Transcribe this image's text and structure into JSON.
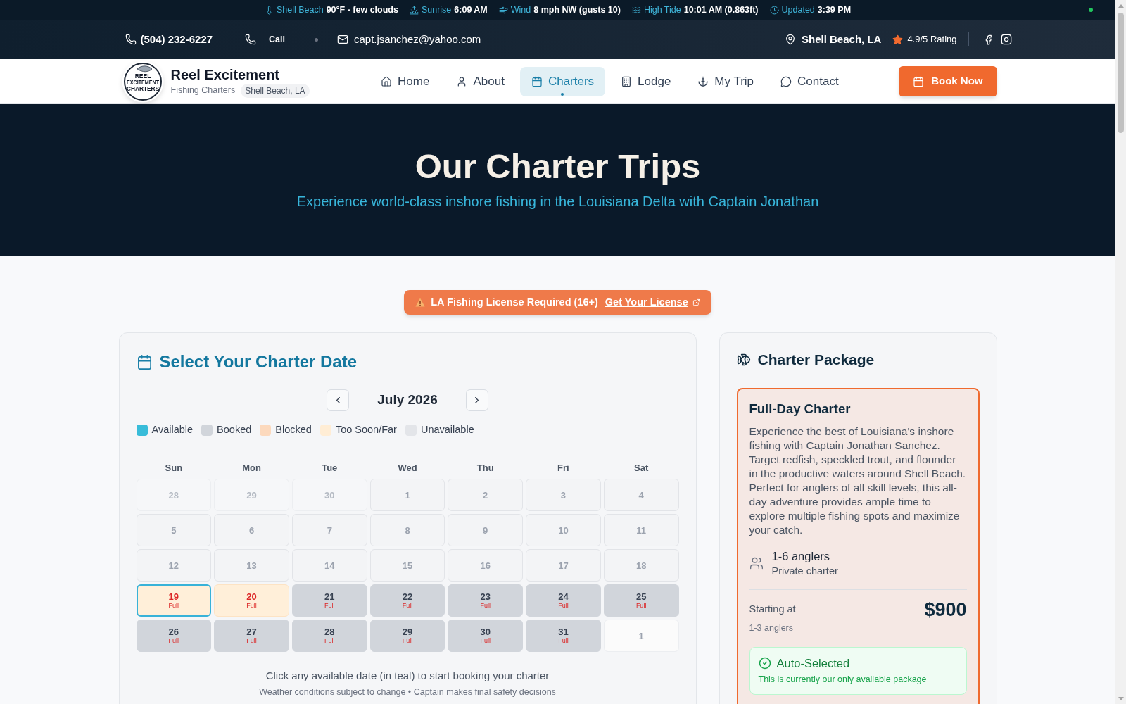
{
  "weather_bar": {
    "items": [
      {
        "label": "Shell Beach",
        "value": "90°F - few clouds"
      },
      {
        "label": "Sunrise",
        "value": "6:09 AM"
      },
      {
        "label": "Wind",
        "value": "8 mph NW (gusts 10)"
      },
      {
        "label": "High Tide",
        "value": "10:01 AM (0.863ft)"
      },
      {
        "label": "Updated",
        "value": "3:39 PM"
      }
    ]
  },
  "contact_bar": {
    "phone": "(504) 232-6227",
    "call": "Call",
    "email": "capt.jsanchez@yahoo.com",
    "location": "Shell Beach, LA",
    "rating": "4.9/5 Rating"
  },
  "nav": {
    "logo": {
      "lines": [
        "REEL",
        "EXCITEMENT",
        "CHARTERS"
      ]
    },
    "brand": {
      "name": "Reel Excitement",
      "tagline": "Fishing Charters",
      "badge": "Shell Beach, LA"
    },
    "items": [
      {
        "label": "Home",
        "selected": false
      },
      {
        "label": "About",
        "selected": false
      },
      {
        "label": "Charters",
        "selected": true
      },
      {
        "label": "Lodge",
        "selected": false
      },
      {
        "label": "My Trip",
        "selected": false
      },
      {
        "label": "Contact",
        "selected": false
      }
    ],
    "cta": "Book Now"
  },
  "hero": {
    "title": "Our Charter Trips",
    "subtitle": "Experience world-class inshore fishing in the Louisiana Delta with Captain Jonathan"
  },
  "license_banner": {
    "text": "LA Fishing License Required (16+)",
    "link": "Get Your License"
  },
  "calendar": {
    "title": "Select Your Charter Date",
    "month": "July 2026",
    "legend": [
      {
        "label": "Available",
        "color": "#38bcd9"
      },
      {
        "label": "Booked",
        "color": "#d1d5db"
      },
      {
        "label": "Blocked",
        "color": "#fcd9bd"
      },
      {
        "label": "Too Soon/Far",
        "color": "#ffedd5"
      },
      {
        "label": "Unavailable",
        "color": "#e3e5e9"
      }
    ],
    "weekdays": [
      "Sun",
      "Mon",
      "Tue",
      "Wed",
      "Thu",
      "Fri",
      "Sat"
    ],
    "days": [
      {
        "day": "28",
        "kind": "outside-past",
        "selected": false
      },
      {
        "day": "29",
        "kind": "outside-past",
        "selected": false
      },
      {
        "day": "30",
        "kind": "outside-past",
        "selected": false
      },
      {
        "day": "1",
        "kind": "unavailable",
        "selected": false
      },
      {
        "day": "2",
        "kind": "unavailable",
        "selected": false
      },
      {
        "day": "3",
        "kind": "unavailable",
        "selected": false
      },
      {
        "day": "4",
        "kind": "unavailable",
        "selected": false
      },
      {
        "day": "5",
        "kind": "unavailable",
        "selected": false
      },
      {
        "day": "6",
        "kind": "unavailable",
        "selected": false
      },
      {
        "day": "7",
        "kind": "unavailable",
        "selected": false
      },
      {
        "day": "8",
        "kind": "unavailable",
        "selected": false
      },
      {
        "day": "9",
        "kind": "unavailable",
        "selected": false
      },
      {
        "day": "10",
        "kind": "unavailable",
        "selected": false
      },
      {
        "day": "11",
        "kind": "unavailable",
        "selected": false
      },
      {
        "day": "12",
        "kind": "unavailable",
        "selected": false
      },
      {
        "day": "13",
        "kind": "unavailable",
        "selected": false
      },
      {
        "day": "14",
        "kind": "unavailable",
        "selected": false
      },
      {
        "day": "15",
        "kind": "unavailable",
        "selected": false
      },
      {
        "day": "16",
        "kind": "unavailable",
        "selected": false
      },
      {
        "day": "17",
        "kind": "unavailable",
        "selected": false
      },
      {
        "day": "18",
        "kind": "unavailable",
        "selected": false
      },
      {
        "day": "19",
        "kind": "too-soon",
        "note": "Full",
        "selected": true
      },
      {
        "day": "20",
        "kind": "too-soon",
        "note": "Full",
        "selected": false
      },
      {
        "day": "21",
        "kind": "booked",
        "note": "Full",
        "selected": false
      },
      {
        "day": "22",
        "kind": "booked",
        "note": "Full",
        "selected": false
      },
      {
        "day": "23",
        "kind": "booked",
        "note": "Full",
        "selected": false
      },
      {
        "day": "24",
        "kind": "booked",
        "note": "Full",
        "selected": false
      },
      {
        "day": "25",
        "kind": "booked",
        "note": "Full",
        "selected": false
      },
      {
        "day": "26",
        "kind": "booked",
        "note": "Full",
        "selected": false
      },
      {
        "day": "27",
        "kind": "booked",
        "note": "Full",
        "selected": false
      },
      {
        "day": "28",
        "kind": "booked",
        "note": "Full",
        "selected": false
      },
      {
        "day": "29",
        "kind": "booked",
        "note": "Full",
        "selected": false
      },
      {
        "day": "30",
        "kind": "booked",
        "note": "Full",
        "selected": false
      },
      {
        "day": "31",
        "kind": "booked",
        "note": "Full",
        "selected": false
      },
      {
        "day": "1",
        "kind": "outside-future",
        "selected": false
      }
    ],
    "hint": "Click any available date (in teal) to start booking your charter",
    "note": "Weather conditions subject to change • Captain makes final safety decisions"
  },
  "package_panel": {
    "title": "Charter Package",
    "package": {
      "name": "Full-Day Charter",
      "selected": true,
      "description": "Experience the best of Louisiana's inshore fishing with Captain Jonathan Sanchez. Target redfish, speckled trout, and flounder in the productive waters around Shell Beach. Perfect for anglers of all skill levels, this all-day adventure provides ample time to explore multiple fishing spots and maximize your catch.",
      "capacity": "1-6 anglers",
      "capacity_note": "Private charter",
      "price_label": "Starting at",
      "price": "$900",
      "price_note": "1-3 anglers",
      "auto_selected": {
        "title": "Auto-Selected",
        "text": "This is currently our only available package"
      }
    }
  }
}
